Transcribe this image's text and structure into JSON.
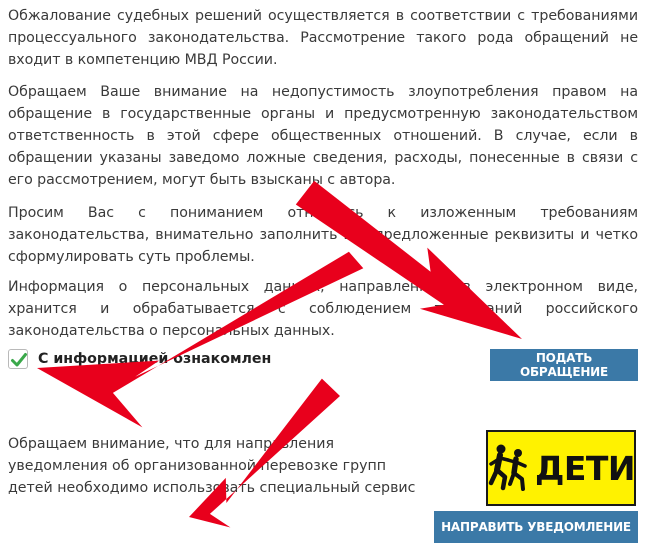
{
  "paragraphs": {
    "appeal": "Обжалование судебных решений осуществляется в соответствии с требованиями процессуального законодательства. Рассмотрение такого рода обращений не входит в компетенцию МВД России.",
    "abuse": "Обращаем Ваше внимание на недопустимость злоупотребления правом на обращение в государственные органы и предусмотренную законодательством ответственность в этой сфере общественных отношений. В случае, если в обращении указаны заведомо ложные сведения, расходы, понесенные в связи с его рассмотрением, могут быть взысканы с автора.",
    "request": "Просим Вас с пониманием отнестись к изложенным требованиям законодательства, внимательно заполнить все предложенные реквизиты и четко сформулировать суть проблемы.",
    "personal_data": "Информация о персональных данных, направленных в электронном виде, хранится и обрабатывается с соблюдением требований российского законодательства о персональных данных."
  },
  "acknowledge": {
    "label": "С информацией ознакомлен",
    "checked": true
  },
  "submit_button": "Подать обращение",
  "children_notice": "Обращаем внимание, что для направления уведомления об организованной перевозке групп детей необходимо использовать специальный сервис",
  "children_badge": "ДЕТИ",
  "notify_button": "Направить уведомление",
  "colors": {
    "button": "#3b79a7",
    "arrow": "#e8001c",
    "badge": "#fff200",
    "check": "#3aa84a"
  }
}
